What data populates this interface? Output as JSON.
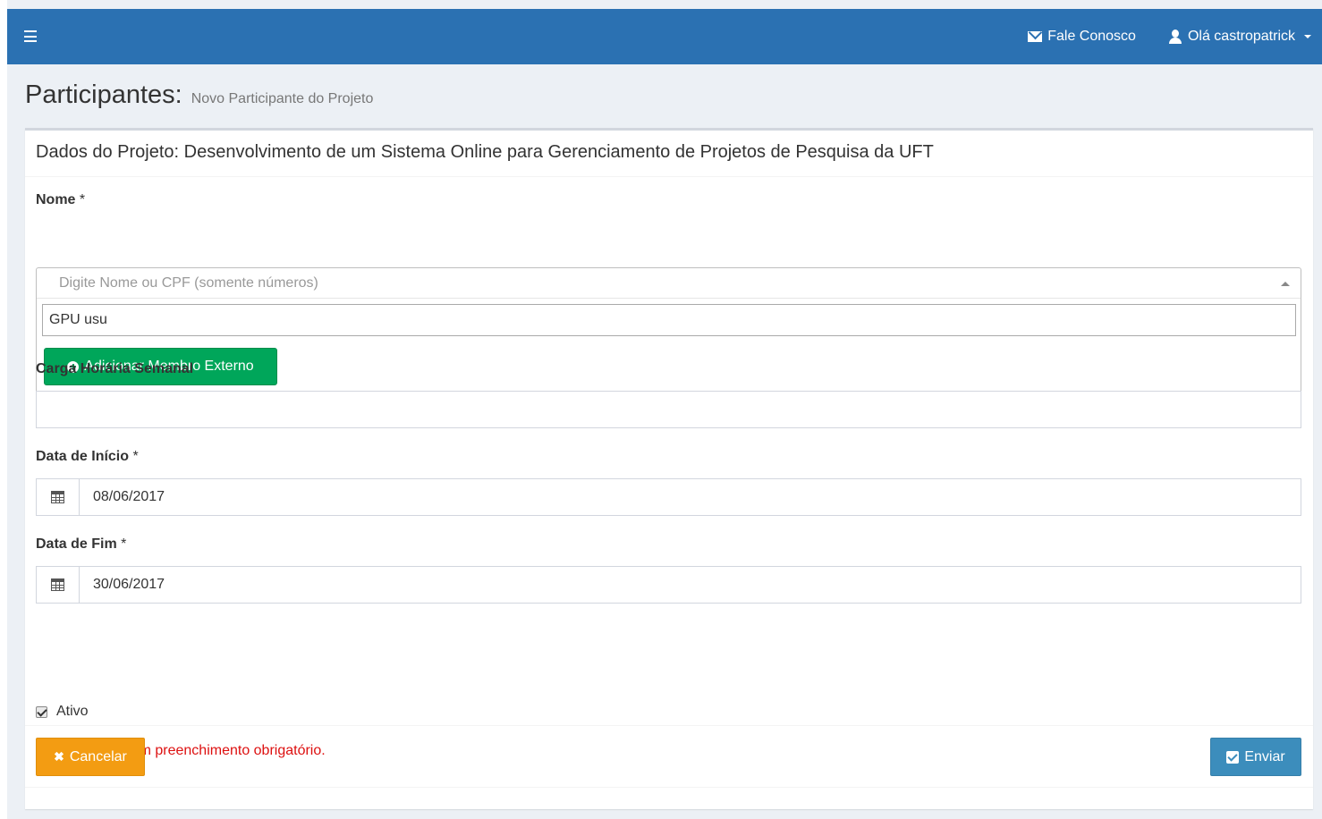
{
  "navbar": {
    "contact_label": "Fale Conosco",
    "user_label": "Olá castropatrick"
  },
  "header": {
    "title": "Participantes:",
    "subtitle": "Novo Participante do Projeto"
  },
  "box": {
    "title": "Dados do Projeto: Desenvolvimento de um Sistema Online para Gerenciamento de Projetos de Pesquisa da UFT"
  },
  "form": {
    "nome_label": "Nome",
    "required_mark": "*",
    "nome_placeholder": "Digite Nome ou CPF (somente números)",
    "search_value": "GPU usu",
    "add_external_label": "Adicionar Membro Externo",
    "carga_label": "Carga Horária Semanal",
    "carga_value": "",
    "data_inicio_label": "Data de Início",
    "data_inicio_value": "08/06/2017",
    "data_fim_label": "Data de Fim",
    "data_fim_value": "30/06/2017",
    "ativo_label": "Ativo",
    "ativo_checked": true,
    "required_note": "* Campos com preenchimento obrigatório."
  },
  "footer": {
    "cancel_label": "Cancelar",
    "send_label": "Enviar"
  },
  "colors": {
    "navbar": "#2b71b2",
    "success": "#00a65a",
    "warning": "#f39c12",
    "primary": "#3c8dbc",
    "danger_text": "#dd1010"
  }
}
